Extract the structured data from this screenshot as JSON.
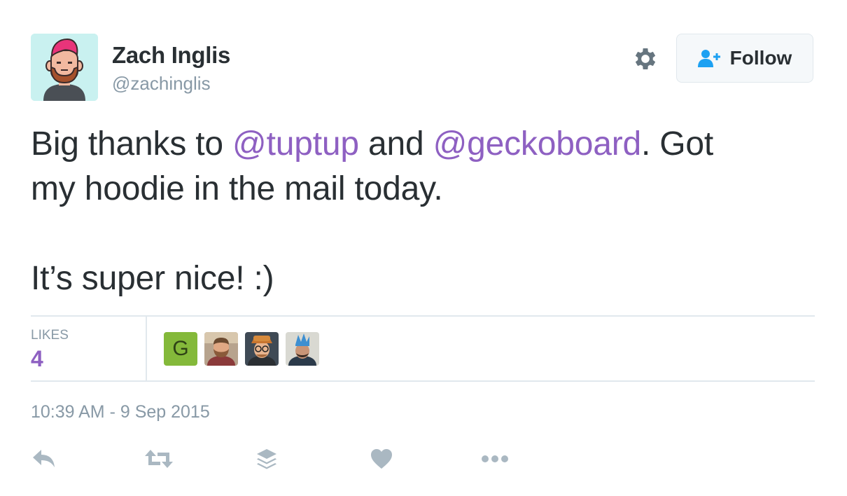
{
  "user": {
    "name": "Zach Inglis",
    "handle": "@zachinglis"
  },
  "follow_button": {
    "label": "Follow"
  },
  "tweet": {
    "line1_prefix": "Big thanks to ",
    "mention1": "@tuptup",
    "line1_mid": " and ",
    "mention2": "@geckoboard",
    "line1_suffix": ". Got",
    "line2": "my hoodie in the mail today.",
    "line3": "It’s super nice! :)"
  },
  "stats": {
    "likes_label": "LIKES",
    "likes_count": "4"
  },
  "likers": [
    {
      "initial": "G",
      "color": "#84b93a"
    },
    {
      "icon": "avatar-bearded-man"
    },
    {
      "icon": "avatar-man-with-hat"
    },
    {
      "icon": "avatar-man-with-crown-hat"
    }
  ],
  "timestamp": "10:39 AM - 9 Sep 2015",
  "actions": [
    "reply-icon",
    "retweet-icon",
    "buffer-icon",
    "like-icon",
    "more-icon"
  ],
  "colors": {
    "mention": "#8e60c2",
    "text": "#292f33",
    "muted": "#8899a6",
    "follow_icon": "#1da1f2",
    "action_icon": "#aab8c2"
  }
}
